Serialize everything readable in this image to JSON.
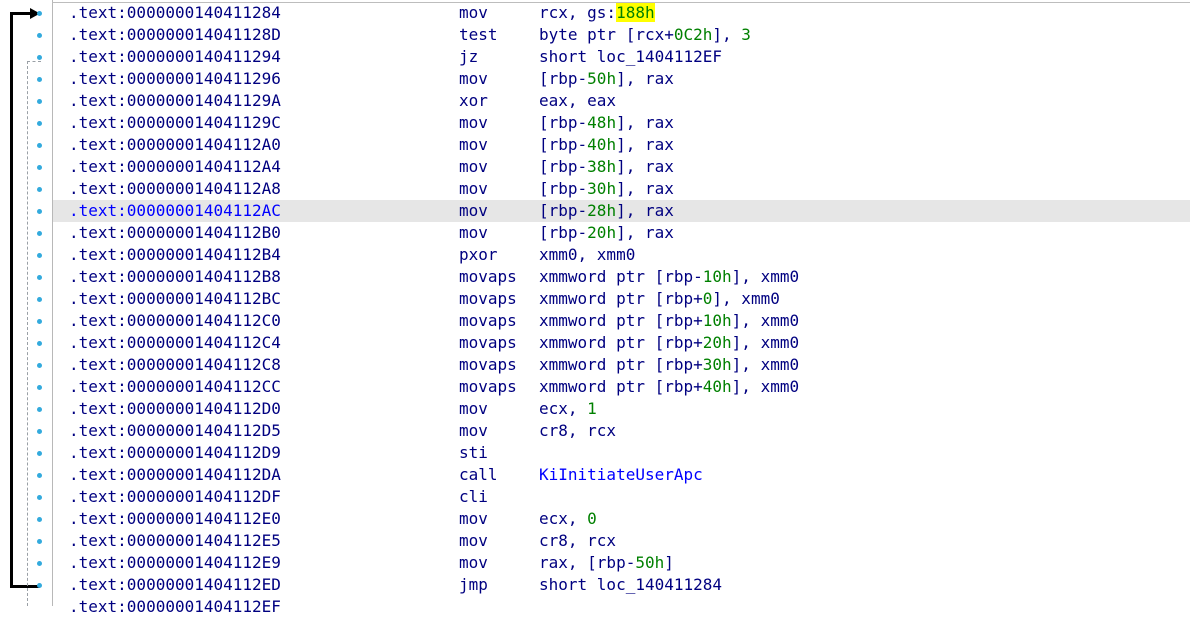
{
  "colors": {
    "mnemonic": "#000080",
    "number": "#008000",
    "name": "#0000ff",
    "selected_row_bg": "#e6e6e6",
    "highlight": "#ffff00",
    "gutter_dot": "#33aadd"
  },
  "selected_index": 9,
  "rows": [
    {
      "addr": ".text:0000000140411284",
      "mnem": "mov",
      "ops": [
        {
          "t": "rcx, gs:"
        },
        {
          "t": "188h",
          "c": "hl"
        }
      ]
    },
    {
      "addr": ".text:000000014041128D",
      "mnem": "test",
      "ops": [
        {
          "t": "byte ptr [rcx+"
        },
        {
          "t": "0C2h",
          "c": "num"
        },
        {
          "t": "], "
        },
        {
          "t": "3",
          "c": "num"
        }
      ]
    },
    {
      "addr": ".text:0000000140411294",
      "mnem": "jz",
      "ops": [
        {
          "t": "short loc_1404112EF"
        }
      ]
    },
    {
      "addr": ".text:0000000140411296",
      "mnem": "mov",
      "ops": [
        {
          "t": "[rbp-"
        },
        {
          "t": "50h",
          "c": "num"
        },
        {
          "t": "], rax"
        }
      ]
    },
    {
      "addr": ".text:000000014041129A",
      "mnem": "xor",
      "ops": [
        {
          "t": "eax, eax"
        }
      ]
    },
    {
      "addr": ".text:000000014041129C",
      "mnem": "mov",
      "ops": [
        {
          "t": "[rbp-"
        },
        {
          "t": "48h",
          "c": "num"
        },
        {
          "t": "], rax"
        }
      ]
    },
    {
      "addr": ".text:00000001404112A0",
      "mnem": "mov",
      "ops": [
        {
          "t": "[rbp-"
        },
        {
          "t": "40h",
          "c": "num"
        },
        {
          "t": "], rax"
        }
      ]
    },
    {
      "addr": ".text:00000001404112A4",
      "mnem": "mov",
      "ops": [
        {
          "t": "[rbp-"
        },
        {
          "t": "38h",
          "c": "num"
        },
        {
          "t": "], rax"
        }
      ]
    },
    {
      "addr": ".text:00000001404112A8",
      "mnem": "mov",
      "ops": [
        {
          "t": "[rbp-"
        },
        {
          "t": "30h",
          "c": "num"
        },
        {
          "t": "], rax"
        }
      ]
    },
    {
      "addr": ".text:00000001404112AC",
      "mnem": "mov",
      "ops": [
        {
          "t": "[rbp-"
        },
        {
          "t": "28h",
          "c": "num"
        },
        {
          "t": "], rax"
        }
      ]
    },
    {
      "addr": ".text:00000001404112B0",
      "mnem": "mov",
      "ops": [
        {
          "t": "[rbp-"
        },
        {
          "t": "20h",
          "c": "num"
        },
        {
          "t": "], rax"
        }
      ]
    },
    {
      "addr": ".text:00000001404112B4",
      "mnem": "pxor",
      "ops": [
        {
          "t": "xmm0, xmm0"
        }
      ]
    },
    {
      "addr": ".text:00000001404112B8",
      "mnem": "movaps",
      "ops": [
        {
          "t": "xmmword ptr [rbp-"
        },
        {
          "t": "10h",
          "c": "num"
        },
        {
          "t": "], xmm0"
        }
      ]
    },
    {
      "addr": ".text:00000001404112BC",
      "mnem": "movaps",
      "ops": [
        {
          "t": "xmmword ptr [rbp+"
        },
        {
          "t": "0",
          "c": "num"
        },
        {
          "t": "], xmm0"
        }
      ]
    },
    {
      "addr": ".text:00000001404112C0",
      "mnem": "movaps",
      "ops": [
        {
          "t": "xmmword ptr [rbp+"
        },
        {
          "t": "10h",
          "c": "num"
        },
        {
          "t": "], xmm0"
        }
      ]
    },
    {
      "addr": ".text:00000001404112C4",
      "mnem": "movaps",
      "ops": [
        {
          "t": "xmmword ptr [rbp+"
        },
        {
          "t": "20h",
          "c": "num"
        },
        {
          "t": "], xmm0"
        }
      ]
    },
    {
      "addr": ".text:00000001404112C8",
      "mnem": "movaps",
      "ops": [
        {
          "t": "xmmword ptr [rbp+"
        },
        {
          "t": "30h",
          "c": "num"
        },
        {
          "t": "], xmm0"
        }
      ]
    },
    {
      "addr": ".text:00000001404112CC",
      "mnem": "movaps",
      "ops": [
        {
          "t": "xmmword ptr [rbp+"
        },
        {
          "t": "40h",
          "c": "num"
        },
        {
          "t": "], xmm0"
        }
      ]
    },
    {
      "addr": ".text:00000001404112D0",
      "mnem": "mov",
      "ops": [
        {
          "t": "ecx, "
        },
        {
          "t": "1",
          "c": "num"
        }
      ]
    },
    {
      "addr": ".text:00000001404112D5",
      "mnem": "mov",
      "ops": [
        {
          "t": "cr8, rcx"
        }
      ]
    },
    {
      "addr": ".text:00000001404112D9",
      "mnem": "sti",
      "ops": []
    },
    {
      "addr": ".text:00000001404112DA",
      "mnem": "call",
      "ops": [
        {
          "t": "KiInitiateUserApc",
          "c": "name"
        }
      ]
    },
    {
      "addr": ".text:00000001404112DF",
      "mnem": "cli",
      "ops": []
    },
    {
      "addr": ".text:00000001404112E0",
      "mnem": "mov",
      "ops": [
        {
          "t": "ecx, "
        },
        {
          "t": "0",
          "c": "num"
        }
      ]
    },
    {
      "addr": ".text:00000001404112E5",
      "mnem": "mov",
      "ops": [
        {
          "t": "cr8, rcx"
        }
      ]
    },
    {
      "addr": ".text:00000001404112E9",
      "mnem": "mov",
      "ops": [
        {
          "t": "rax, [rbp-"
        },
        {
          "t": "50h",
          "c": "num"
        },
        {
          "t": "]"
        }
      ]
    },
    {
      "addr": ".text:00000001404112ED",
      "mnem": "jmp",
      "ops": [
        {
          "t": "short loc_140411284"
        }
      ]
    },
    {
      "addr": ".text:00000001404112EF",
      "mnem": "",
      "ops": []
    }
  ]
}
